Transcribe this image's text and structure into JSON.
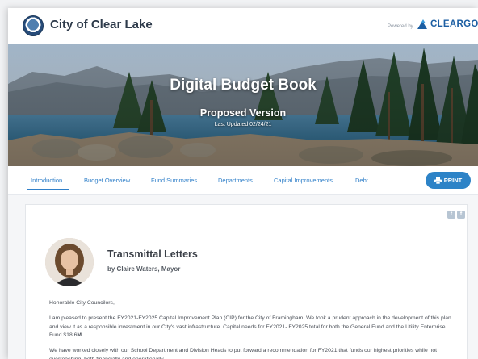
{
  "header": {
    "site_title": "City of Clear Lake",
    "powered_by": "Powered by",
    "brand": "CLEARGOV"
  },
  "hero": {
    "title": "Digital Budget Book",
    "subtitle": "Proposed Version",
    "updated": "Last Updated 02/24/21"
  },
  "nav": {
    "tabs": [
      {
        "label": "Introduction"
      },
      {
        "label": "Budget Overview"
      },
      {
        "label": "Fund Summaries"
      },
      {
        "label": "Departments"
      },
      {
        "label": "Capital Improvements"
      },
      {
        "label": "Debt"
      }
    ],
    "active_tab": "Introduction",
    "print_label": "PRINT"
  },
  "letter": {
    "social": [
      "twitter-icon",
      "facebook-icon"
    ],
    "title": "Transmittal Letters",
    "author": "by Claire Waters, Mayor",
    "greeting": "Honorable City Councilors,",
    "para1_a": "I am pleased to present the FY2021-FY2025 Capital Improvement Plan (CIP) for the City of Framingham. We took a prudent approach in the development of this plan and view it as a responsible investment in our City's vast infrastructure. Capital needs for FY2021- FY2025 total for both the General Fund and the Utility Enterprise Fund.$18.6",
    "para1_b": "M",
    "para2": "We have worked closely with our School Department and Division Heads to put forward a recommendation for FY2021 that funds our highest priorities while not overreaching, both financially and operationally."
  },
  "colors": {
    "accent": "#2f7fc9",
    "print_button": "#2d83c7",
    "brand": "#1d5fa3"
  }
}
